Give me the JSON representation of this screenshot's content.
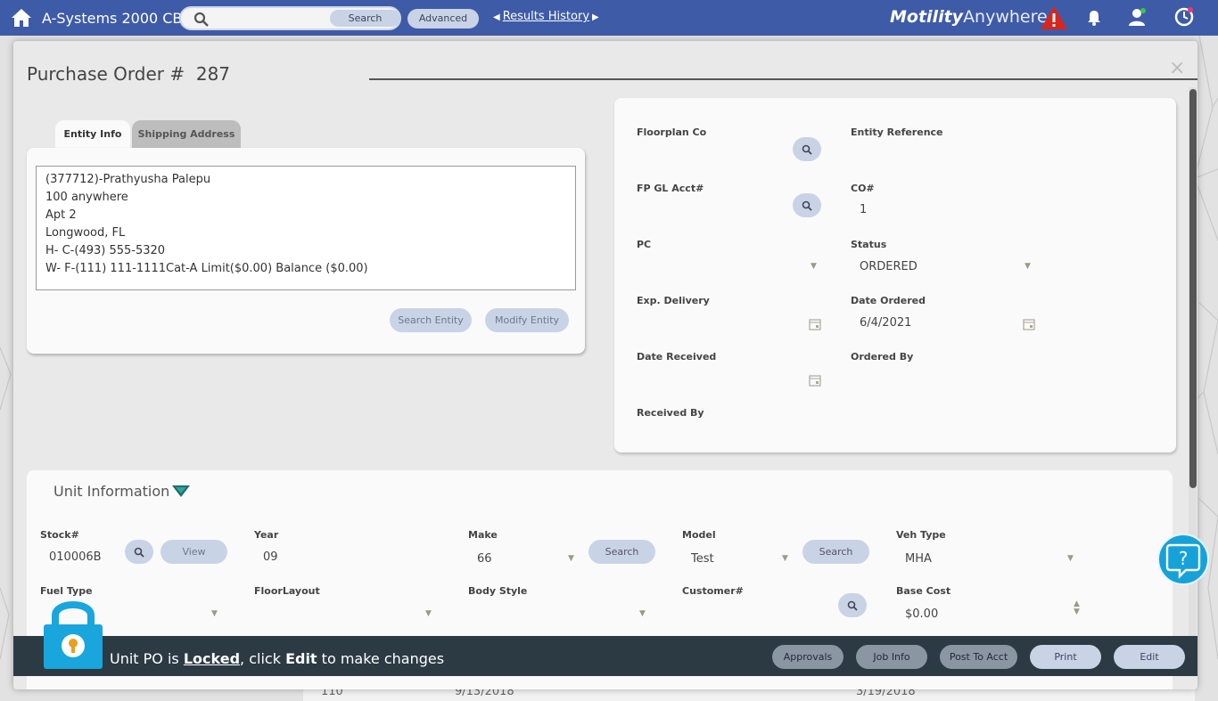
{
  "header": {
    "app_title": "A-Systems 2000 CB",
    "search": {
      "placeholder": "",
      "button_label": "Search"
    },
    "advanced_label": "Advanced",
    "results_history_label": "Results History",
    "brand": {
      "bold": "Motility",
      "light": "Anywhere"
    },
    "icons": [
      "home-icon",
      "search-icon",
      "alert-icon",
      "bell-icon",
      "user-icon",
      "clock-icon"
    ]
  },
  "modal": {
    "title_prefix": "Purchase Order #",
    "po_number": "287",
    "close_label": "×"
  },
  "entity": {
    "tabs": [
      {
        "label": "Entity Info",
        "active": true
      },
      {
        "label": "Shipping Address",
        "active": false
      }
    ],
    "lines": [
      "(377712)-Prathyusha Palepu",
      "100 anywhere",
      "Apt 2",
      "Longwood, FL",
      "H- C-(493) 555-5320",
      "W- F-(111) 111-1111Cat-A Limit($0.00) Balance ($0.00)"
    ],
    "search_entity_label": "Search Entity",
    "modify_entity_label": "Modify Entity"
  },
  "po_fields": {
    "floorplan_co": {
      "label": "Floorplan Co",
      "value": ""
    },
    "entity_reference": {
      "label": "Entity Reference",
      "value": ""
    },
    "fp_gl_acct": {
      "label": "FP GL Acct#",
      "value": ""
    },
    "co": {
      "label": "CO#",
      "value": "1"
    },
    "pc": {
      "label": "PC",
      "value": ""
    },
    "status": {
      "label": "Status",
      "value": "ORDERED"
    },
    "exp_delivery": {
      "label": "Exp. Delivery",
      "value": ""
    },
    "date_ordered": {
      "label": "Date Ordered",
      "value": "6/4/2021"
    },
    "date_received": {
      "label": "Date Received",
      "value": ""
    },
    "ordered_by": {
      "label": "Ordered By",
      "value": ""
    },
    "received_by": {
      "label": "Received By",
      "value": ""
    }
  },
  "unit": {
    "title": "Unit Information",
    "stock": {
      "label": "Stock#",
      "value": "010006B",
      "view_label": "View"
    },
    "year": {
      "label": "Year",
      "value": "09"
    },
    "make": {
      "label": "Make",
      "value": "66",
      "search_label": "Search"
    },
    "model": {
      "label": "Model",
      "value": "Test",
      "search_label": "Search"
    },
    "veh_type": {
      "label": "Veh Type",
      "value": "MHA"
    },
    "fuel_type": {
      "label": "Fuel Type",
      "value": ""
    },
    "floor_layout": {
      "label": "FloorLayout",
      "value": ""
    },
    "body_style": {
      "label": "Body Style",
      "value": ""
    },
    "customer": {
      "label": "Customer#",
      "value": ""
    },
    "base_cost": {
      "label": "Base Cost",
      "value": "$0.00"
    }
  },
  "lockbar": {
    "msg_pre": "Unit PO is ",
    "msg_locked": "Locked",
    "msg_mid": ", click ",
    "msg_edit": "Edit",
    "msg_post": " to make changes",
    "buttons": {
      "approvals": "Approvals",
      "job_info": "Job Info",
      "post_to_acct": "Post To Acct",
      "print": "Print",
      "edit": "Edit"
    }
  },
  "background_row": {
    "c1": "110",
    "c2": "9/13/2018",
    "c3": "3/19/2018"
  },
  "help_label": "?"
}
